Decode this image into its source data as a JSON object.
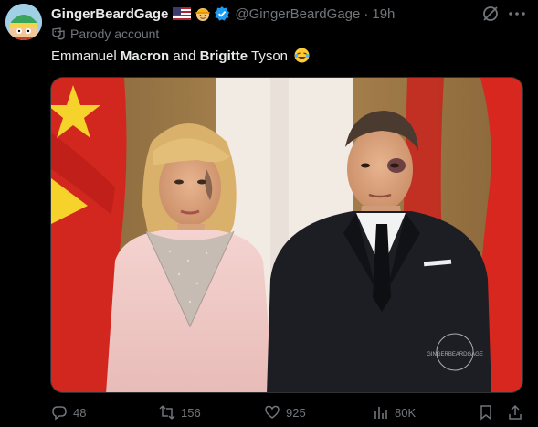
{
  "author": {
    "display_name": "GingerBeardGage",
    "handle": "@GingerBeardGage",
    "separator": "·",
    "time": "19h",
    "label": "Parody account"
  },
  "tweet": {
    "text_1": "Emmanuel ",
    "bold_1": "Macron",
    "text_2": " and ",
    "bold_2": "Brigitte",
    "text_3": " Tyson"
  },
  "image": {
    "watermark": "GINGERBEARDGAGE"
  },
  "actions": {
    "replies": "48",
    "reposts": "156",
    "likes": "925",
    "views": "80K"
  },
  "icons": {
    "reply": "reply-icon",
    "repost": "repost-icon",
    "like": "heart-icon",
    "views": "views-icon",
    "bookmark": "bookmark-icon",
    "share": "share-icon",
    "grok": "grok-icon",
    "more": "more-icon"
  },
  "colors": {
    "background": "#000000",
    "text": "#e7e9ea",
    "muted": "#71767b",
    "verified": "#1d9bf0"
  }
}
